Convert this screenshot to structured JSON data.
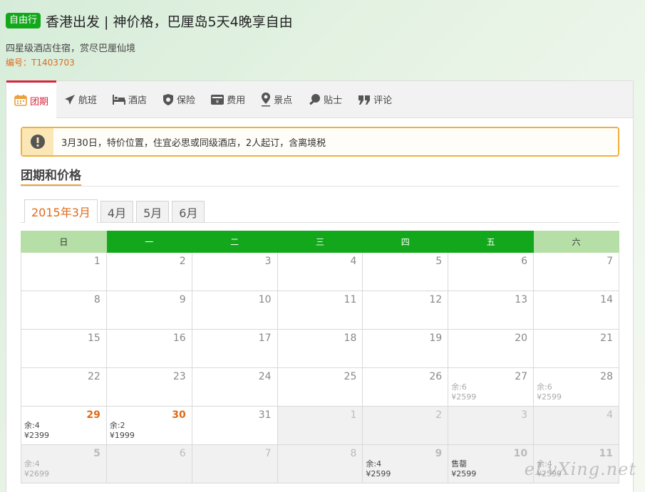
{
  "header": {
    "tag": "自由行",
    "title": "香港出发 | 神价格，巴厘岛5天4晚享自由",
    "subtitle": "四星级酒店住宿，赏尽巴厘仙境",
    "code": "编号：T1403703"
  },
  "tabs": [
    {
      "label": "团期",
      "icon": "calendar-icon"
    },
    {
      "label": "航班",
      "icon": "plane-icon"
    },
    {
      "label": "酒店",
      "icon": "bed-icon"
    },
    {
      "label": "保险",
      "icon": "shield-icon"
    },
    {
      "label": "费用",
      "icon": "wallet-icon"
    },
    {
      "label": "景点",
      "icon": "location-pin-icon"
    },
    {
      "label": "贴士",
      "icon": "bulb-icon"
    },
    {
      "label": "评论",
      "icon": "quote-icon"
    }
  ],
  "notice": "3月30日，特价位置，住宜必思或同级酒店，2人起订，含离境税",
  "section_title": "团期和价格",
  "month_tabs": [
    "2015年3月",
    "4月",
    "5月",
    "6月"
  ],
  "weekdays": [
    "日",
    "一",
    "二",
    "三",
    "四",
    "五",
    "六"
  ],
  "calendar": [
    [
      {
        "d": "1"
      },
      {
        "d": "2"
      },
      {
        "d": "3"
      },
      {
        "d": "4"
      },
      {
        "d": "5"
      },
      {
        "d": "6"
      },
      {
        "d": "7"
      }
    ],
    [
      {
        "d": "8"
      },
      {
        "d": "9"
      },
      {
        "d": "10"
      },
      {
        "d": "11"
      },
      {
        "d": "12"
      },
      {
        "d": "13"
      },
      {
        "d": "14"
      }
    ],
    [
      {
        "d": "15"
      },
      {
        "d": "16"
      },
      {
        "d": "17"
      },
      {
        "d": "18"
      },
      {
        "d": "19"
      },
      {
        "d": "20"
      },
      {
        "d": "21"
      }
    ],
    [
      {
        "d": "22"
      },
      {
        "d": "23"
      },
      {
        "d": "24"
      },
      {
        "d": "25"
      },
      {
        "d": "26"
      },
      {
        "d": "27",
        "l1": "余:6",
        "l2": "¥2599",
        "faded": true
      },
      {
        "d": "28",
        "l1": "余:6",
        "l2": "¥2599",
        "faded": true
      }
    ],
    [
      {
        "d": "29",
        "l1": "余:4",
        "l2": "¥2399",
        "hl": true
      },
      {
        "d": "30",
        "l1": "余:2",
        "l2": "¥1999",
        "hl": true
      },
      {
        "d": "31"
      },
      {
        "d": "1",
        "other": true
      },
      {
        "d": "2",
        "other": true
      },
      {
        "d": "3",
        "other": true
      },
      {
        "d": "4",
        "other": true
      }
    ],
    [
      {
        "d": "5",
        "other": true,
        "bold": true,
        "l1": "余:4",
        "l2": "¥2699",
        "faded": true
      },
      {
        "d": "6",
        "other": true
      },
      {
        "d": "7",
        "other": true
      },
      {
        "d": "8",
        "other": true
      },
      {
        "d": "9",
        "other": true,
        "bold": true,
        "l1": "余:4",
        "l2": "¥2599"
      },
      {
        "d": "10",
        "other": true,
        "bold": true,
        "l1": "售罄",
        "l2": "¥2599"
      },
      {
        "d": "11",
        "other": true,
        "bold": true,
        "l1": "余:4",
        "l2": "¥2599",
        "faded": true
      }
    ]
  ],
  "watermark": "eLvXing.net",
  "colors": {
    "brand_green": "#13a81c",
    "accent_red": "#d9233b",
    "accent_orange": "#e06a1a"
  }
}
